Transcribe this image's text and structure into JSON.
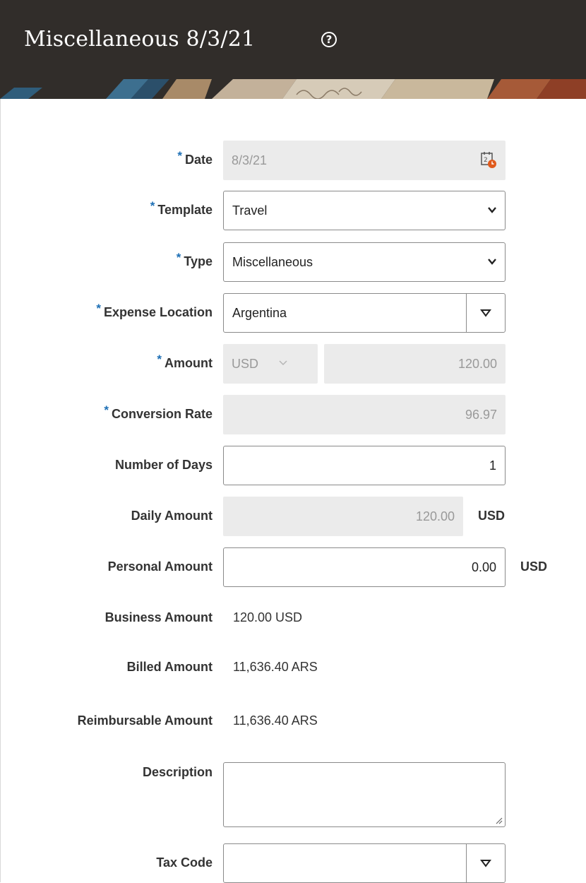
{
  "header": {
    "title": "Miscellaneous 8/3/21",
    "help_icon": "help-circle-icon"
  },
  "form": {
    "required_mark": "*",
    "date": {
      "label": "Date",
      "value": "8/3/21",
      "icon": "calendar-clock-icon"
    },
    "template": {
      "label": "Template",
      "value": "Travel"
    },
    "type": {
      "label": "Type",
      "value": "Miscellaneous"
    },
    "expense_location": {
      "label": "Expense Location",
      "value": "Argentina"
    },
    "amount": {
      "label": "Amount",
      "currency": "USD",
      "value": "120.00"
    },
    "conversion_rate": {
      "label": "Conversion Rate",
      "value": "96.97"
    },
    "number_of_days": {
      "label": "Number of Days",
      "value": "1"
    },
    "daily_amount": {
      "label": "Daily Amount",
      "value": "120.00",
      "unit": "USD"
    },
    "personal_amount": {
      "label": "Personal Amount",
      "value": "0.00",
      "unit": "USD"
    },
    "business_amount": {
      "label": "Business Amount",
      "value": "120.00 USD"
    },
    "billed_amount": {
      "label": "Billed Amount",
      "value": "11,636.40 ARS"
    },
    "reimbursable_amount": {
      "label": "Reimbursable Amount",
      "value": "11,636.40 ARS"
    },
    "description": {
      "label": "Description",
      "value": ""
    },
    "tax_code": {
      "label": "Tax Code",
      "value": ""
    }
  },
  "colors": {
    "header_bg": "#312d2a",
    "required_accent": "#1d6fb5",
    "readonly_bg": "#ebebeb"
  }
}
